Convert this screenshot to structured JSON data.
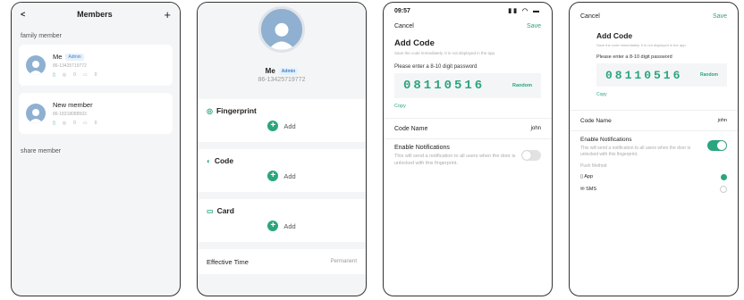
{
  "members": {
    "title": "Members",
    "add": "+",
    "back": "<",
    "family_label": "family member",
    "share_label": "share member",
    "items": [
      {
        "name": "Me",
        "badge": "Admin",
        "phone": "86-13425719772",
        "fp": "0",
        "card": "0"
      },
      {
        "name": "New member",
        "badge": "",
        "phone": "86-18318088593",
        "fp": "0",
        "card": "0"
      }
    ]
  },
  "detail": {
    "name": "Me",
    "badge": "Admin",
    "phone": "86-13425719772",
    "sections": [
      {
        "title": "Fingerprint",
        "add": "Add"
      },
      {
        "title": "Code",
        "add": "Add"
      },
      {
        "title": "Card",
        "add": "Add"
      }
    ],
    "effective_label": "Effective Time",
    "effective_value": "Permanent"
  },
  "code": {
    "time": "09:57",
    "cancel": "Cancel",
    "save": "Save",
    "title": "Add Code",
    "subtitle": "Save the code immediately. It is not displayed in the app.",
    "prompt": "Please enter a 8-10 digit password",
    "password": "08110516",
    "random": "Random",
    "copy": "Copy",
    "code_name_label": "Code Name",
    "code_name_value": "john",
    "notify_label": "Enable Notifications",
    "notify_desc": "This will send a notification to all users when the door is unlocked with this fingerprint.",
    "push_label": "Push Method",
    "push_options": [
      "App",
      "SMS"
    ]
  },
  "colors": {
    "accent": "#2aa57f"
  }
}
